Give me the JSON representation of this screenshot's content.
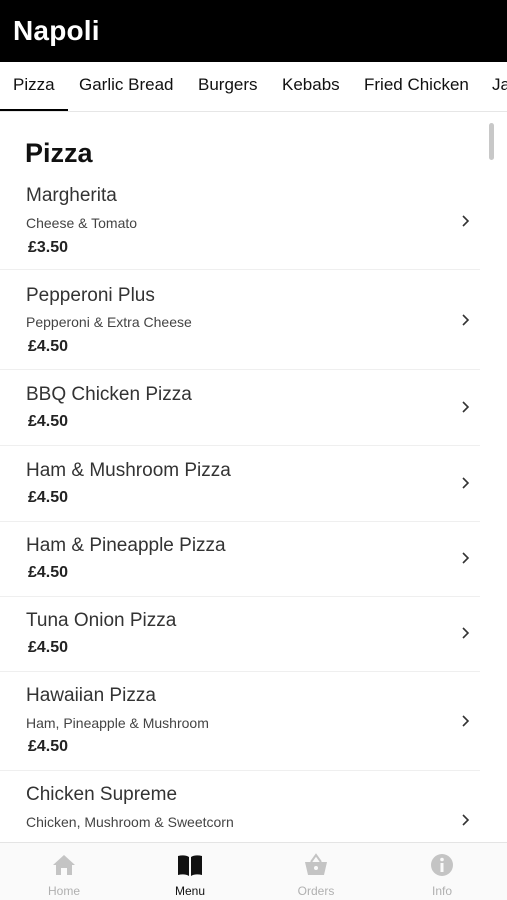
{
  "header": {
    "title": "Napoli"
  },
  "tabs": [
    {
      "label": "Pizza",
      "active": true
    },
    {
      "label": "Garlic Bread"
    },
    {
      "label": "Burgers"
    },
    {
      "label": "Kebabs"
    },
    {
      "label": "Fried Chicken"
    },
    {
      "label": "Ja"
    }
  ],
  "section": {
    "title": "Pizza"
  },
  "items": [
    {
      "name": "Margherita",
      "description": "Cheese & Tomato",
      "price": "£3.50"
    },
    {
      "name": "Pepperoni Plus",
      "description": "Pepperoni & Extra Cheese",
      "price": "£4.50"
    },
    {
      "name": "BBQ Chicken Pizza",
      "price": "£4.50"
    },
    {
      "name": "Ham & Mushroom Pizza",
      "price": "£4.50"
    },
    {
      "name": "Ham & Pineapple Pizza",
      "price": "£4.50"
    },
    {
      "name": "Tuna Onion Pizza",
      "price": "£4.50"
    },
    {
      "name": "Hawaiian Pizza",
      "description": "Ham, Pineapple & Mushroom",
      "price": "£4.50"
    },
    {
      "name": "Chicken Supreme",
      "description": "Chicken, Mushroom & Sweetcorn"
    }
  ],
  "bottom_nav": [
    {
      "label": "Home",
      "icon": "home-icon"
    },
    {
      "label": "Menu",
      "icon": "book-icon",
      "active": true
    },
    {
      "label": "Orders",
      "icon": "basket-icon"
    },
    {
      "label": "Info",
      "icon": "info-icon"
    }
  ],
  "colors": {
    "header_bg": "#000000",
    "active": "#111111",
    "inactive": "#b0b0b0"
  }
}
